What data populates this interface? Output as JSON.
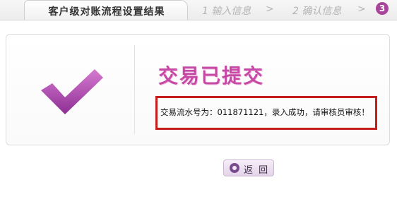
{
  "steps": {
    "active_label": "客户级对账流程设置结果",
    "step1_label": "1 输入信息",
    "step2_label": "2 确认信息",
    "arrow": ">",
    "step3_number": "3"
  },
  "result": {
    "title": "交易已提交",
    "message": "交易流水号为：011871121，录入成功，请审核员审核！"
  },
  "actions": {
    "back_label": "返 回"
  },
  "colors": {
    "accent": "#c64aa5",
    "highlight_border": "#c41d1d",
    "step_badge": "#a8459a"
  },
  "icons": {
    "success": "checkmark-icon",
    "back": "back-circle-icon"
  }
}
